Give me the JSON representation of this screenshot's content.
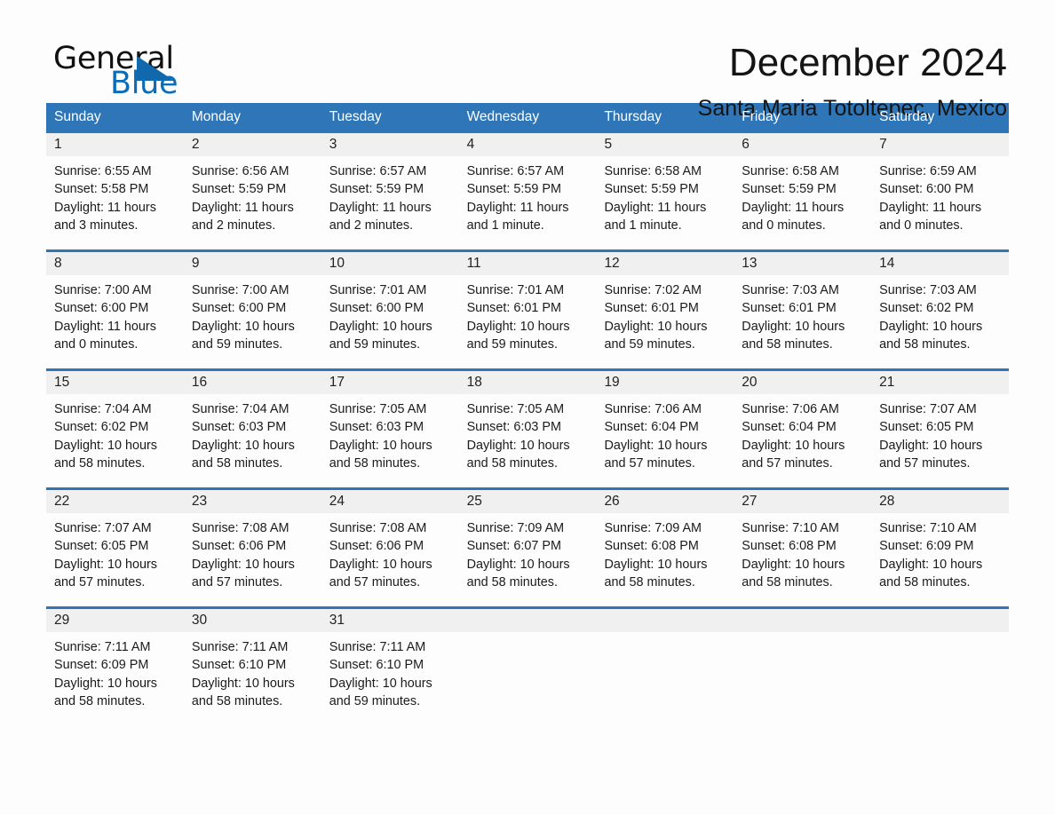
{
  "brand": {
    "word_one": "General",
    "word_two": "Blue",
    "triangle_icon": "triangle-icon"
  },
  "header": {
    "month_title": "December 2024",
    "location": "Santa Maria Totoltepec, Mexico"
  },
  "colors": {
    "header_blue": "#2e76b8",
    "brand_blue": "#0b6cb7",
    "day_band_gray": "#f0f0f0",
    "page_background": "#fdfdfd"
  },
  "weekdays": [
    "Sunday",
    "Monday",
    "Tuesday",
    "Wednesday",
    "Thursday",
    "Friday",
    "Saturday"
  ],
  "weeks": [
    [
      {
        "day": "1",
        "sunrise": "Sunrise: 6:55 AM",
        "sunset": "Sunset: 5:58 PM",
        "daylight": "Daylight: 11 hours and 3 minutes."
      },
      {
        "day": "2",
        "sunrise": "Sunrise: 6:56 AM",
        "sunset": "Sunset: 5:59 PM",
        "daylight": "Daylight: 11 hours and 2 minutes."
      },
      {
        "day": "3",
        "sunrise": "Sunrise: 6:57 AM",
        "sunset": "Sunset: 5:59 PM",
        "daylight": "Daylight: 11 hours and 2 minutes."
      },
      {
        "day": "4",
        "sunrise": "Sunrise: 6:57 AM",
        "sunset": "Sunset: 5:59 PM",
        "daylight": "Daylight: 11 hours and 1 minute."
      },
      {
        "day": "5",
        "sunrise": "Sunrise: 6:58 AM",
        "sunset": "Sunset: 5:59 PM",
        "daylight": "Daylight: 11 hours and 1 minute."
      },
      {
        "day": "6",
        "sunrise": "Sunrise: 6:58 AM",
        "sunset": "Sunset: 5:59 PM",
        "daylight": "Daylight: 11 hours and 0 minutes."
      },
      {
        "day": "7",
        "sunrise": "Sunrise: 6:59 AM",
        "sunset": "Sunset: 6:00 PM",
        "daylight": "Daylight: 11 hours and 0 minutes."
      }
    ],
    [
      {
        "day": "8",
        "sunrise": "Sunrise: 7:00 AM",
        "sunset": "Sunset: 6:00 PM",
        "daylight": "Daylight: 11 hours and 0 minutes."
      },
      {
        "day": "9",
        "sunrise": "Sunrise: 7:00 AM",
        "sunset": "Sunset: 6:00 PM",
        "daylight": "Daylight: 10 hours and 59 minutes."
      },
      {
        "day": "10",
        "sunrise": "Sunrise: 7:01 AM",
        "sunset": "Sunset: 6:00 PM",
        "daylight": "Daylight: 10 hours and 59 minutes."
      },
      {
        "day": "11",
        "sunrise": "Sunrise: 7:01 AM",
        "sunset": "Sunset: 6:01 PM",
        "daylight": "Daylight: 10 hours and 59 minutes."
      },
      {
        "day": "12",
        "sunrise": "Sunrise: 7:02 AM",
        "sunset": "Sunset: 6:01 PM",
        "daylight": "Daylight: 10 hours and 59 minutes."
      },
      {
        "day": "13",
        "sunrise": "Sunrise: 7:03 AM",
        "sunset": "Sunset: 6:01 PM",
        "daylight": "Daylight: 10 hours and 58 minutes."
      },
      {
        "day": "14",
        "sunrise": "Sunrise: 7:03 AM",
        "sunset": "Sunset: 6:02 PM",
        "daylight": "Daylight: 10 hours and 58 minutes."
      }
    ],
    [
      {
        "day": "15",
        "sunrise": "Sunrise: 7:04 AM",
        "sunset": "Sunset: 6:02 PM",
        "daylight": "Daylight: 10 hours and 58 minutes."
      },
      {
        "day": "16",
        "sunrise": "Sunrise: 7:04 AM",
        "sunset": "Sunset: 6:03 PM",
        "daylight": "Daylight: 10 hours and 58 minutes."
      },
      {
        "day": "17",
        "sunrise": "Sunrise: 7:05 AM",
        "sunset": "Sunset: 6:03 PM",
        "daylight": "Daylight: 10 hours and 58 minutes."
      },
      {
        "day": "18",
        "sunrise": "Sunrise: 7:05 AM",
        "sunset": "Sunset: 6:03 PM",
        "daylight": "Daylight: 10 hours and 58 minutes."
      },
      {
        "day": "19",
        "sunrise": "Sunrise: 7:06 AM",
        "sunset": "Sunset: 6:04 PM",
        "daylight": "Daylight: 10 hours and 57 minutes."
      },
      {
        "day": "20",
        "sunrise": "Sunrise: 7:06 AM",
        "sunset": "Sunset: 6:04 PM",
        "daylight": "Daylight: 10 hours and 57 minutes."
      },
      {
        "day": "21",
        "sunrise": "Sunrise: 7:07 AM",
        "sunset": "Sunset: 6:05 PM",
        "daylight": "Daylight: 10 hours and 57 minutes."
      }
    ],
    [
      {
        "day": "22",
        "sunrise": "Sunrise: 7:07 AM",
        "sunset": "Sunset: 6:05 PM",
        "daylight": "Daylight: 10 hours and 57 minutes."
      },
      {
        "day": "23",
        "sunrise": "Sunrise: 7:08 AM",
        "sunset": "Sunset: 6:06 PM",
        "daylight": "Daylight: 10 hours and 57 minutes."
      },
      {
        "day": "24",
        "sunrise": "Sunrise: 7:08 AM",
        "sunset": "Sunset: 6:06 PM",
        "daylight": "Daylight: 10 hours and 57 minutes."
      },
      {
        "day": "25",
        "sunrise": "Sunrise: 7:09 AM",
        "sunset": "Sunset: 6:07 PM",
        "daylight": "Daylight: 10 hours and 58 minutes."
      },
      {
        "day": "26",
        "sunrise": "Sunrise: 7:09 AM",
        "sunset": "Sunset: 6:08 PM",
        "daylight": "Daylight: 10 hours and 58 minutes."
      },
      {
        "day": "27",
        "sunrise": "Sunrise: 7:10 AM",
        "sunset": "Sunset: 6:08 PM",
        "daylight": "Daylight: 10 hours and 58 minutes."
      },
      {
        "day": "28",
        "sunrise": "Sunrise: 7:10 AM",
        "sunset": "Sunset: 6:09 PM",
        "daylight": "Daylight: 10 hours and 58 minutes."
      }
    ],
    [
      {
        "day": "29",
        "sunrise": "Sunrise: 7:11 AM",
        "sunset": "Sunset: 6:09 PM",
        "daylight": "Daylight: 10 hours and 58 minutes."
      },
      {
        "day": "30",
        "sunrise": "Sunrise: 7:11 AM",
        "sunset": "Sunset: 6:10 PM",
        "daylight": "Daylight: 10 hours and 58 minutes."
      },
      {
        "day": "31",
        "sunrise": "Sunrise: 7:11 AM",
        "sunset": "Sunset: 6:10 PM",
        "daylight": "Daylight: 10 hours and 59 minutes."
      },
      {
        "day": "",
        "sunrise": "",
        "sunset": "",
        "daylight": ""
      },
      {
        "day": "",
        "sunrise": "",
        "sunset": "",
        "daylight": ""
      },
      {
        "day": "",
        "sunrise": "",
        "sunset": "",
        "daylight": ""
      },
      {
        "day": "",
        "sunrise": "",
        "sunset": "",
        "daylight": ""
      }
    ]
  ]
}
